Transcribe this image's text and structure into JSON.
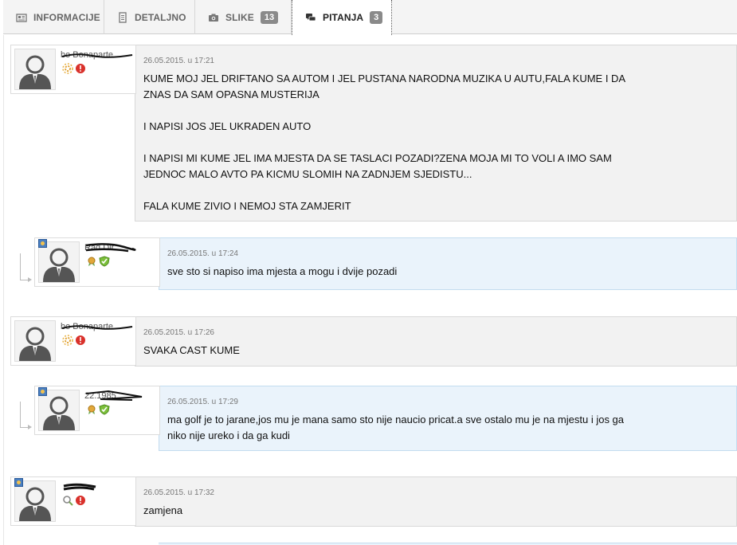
{
  "tabs": [
    {
      "label": "INFORMACIJE",
      "icon": "newspaper-icon"
    },
    {
      "label": "DETALJNO",
      "icon": "document-icon"
    },
    {
      "label": "SLIKE",
      "icon": "camera-icon",
      "badge": "13"
    },
    {
      "label": "PITANJA",
      "icon": "chat-bubbles-icon",
      "badge": "3",
      "active": true
    }
  ],
  "posts": [
    {
      "username": "bo Bonaparte",
      "date": "26.05.2015. u 17:21",
      "text": "KUME MOJ JEL DRIFTANO SA AUTOM I JEL PUSTANA NARODNA MUZIKA U AUTU,FALA KUME I DA\nZNAS DA SAM OPASNA MUSTERIJA\n\nI NAPISI JOS JEL UKRADEN AUTO\n\nI NAPISI MI KUME JEL IMA MJESTA DA SE TASLACI POZADI?ZENA MOJA MI TO VOLI A IMO SAM\nJEDNOC MALO AVTO PA KICMU SLOMIH NA ZADNJEM SJEDISTU...\n\nFALA KUME ZIVIO I NEMOJ STA ZAMJERIT"
    },
    {
      "username": "Rad Dir",
      "date": "26.05.2015. u 17:24",
      "text": "sve sto si napiso ima mjesta a mogu i dvije pozadi"
    },
    {
      "username": "bo Bonaparte",
      "date": "26.05.2015. u 17:26",
      "text": "SVAKA CAST KUME"
    },
    {
      "username": "22.1985",
      "date": "26.05.2015. u 17:29",
      "text": "ma golf je to jarane,jos mu je mana samo sto nije naucio pricat.a sve ostalo mu je na mjestu i jos ga\nniko nije ureko i da ga kudi"
    },
    {
      "username": "",
      "date": "26.05.2015. u 17:32",
      "text": "zamjena"
    }
  ],
  "colors": {
    "reply_bg": "#eaf3fb",
    "post_bg": "#f2f2f2",
    "badge_bg": "#8a8a8a"
  }
}
